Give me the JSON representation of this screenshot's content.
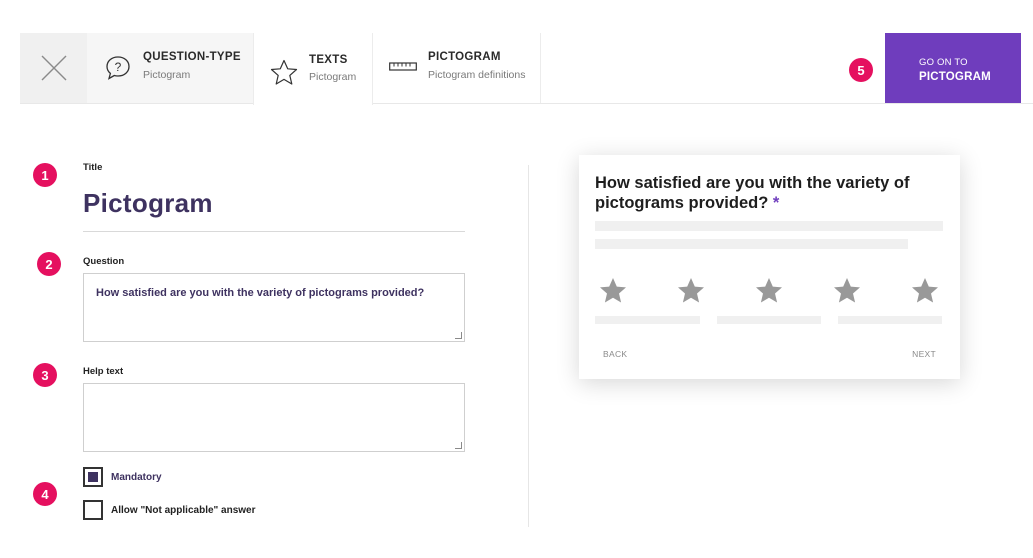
{
  "header": {
    "tabs": [
      {
        "title": "QUESTION-TYPE",
        "subtitle": "Pictogram",
        "icon": "question-bubble-icon"
      },
      {
        "title": "TEXTS",
        "subtitle": "Pictogram",
        "icon": "star-outline-icon",
        "active": true
      },
      {
        "title": "PICTOGRAM",
        "subtitle": "Pictogram definitions",
        "icon": "ruler-icon"
      }
    ],
    "goto": {
      "line1": "GO ON TO",
      "line2": "PICTOGRAM"
    },
    "step_badge": "5"
  },
  "form": {
    "steps": [
      "1",
      "2",
      "3",
      "4"
    ],
    "title_label": "Title",
    "title_value": "Pictogram",
    "question_label": "Question",
    "question_value": "How satisfied are you with the variety of pictograms provided?",
    "helptext_label": "Help text",
    "helptext_value": "",
    "mandatory_label": "Mandatory",
    "mandatory_checked": true,
    "not_applicable_label": "Allow \"Not applicable\" answer",
    "not_applicable_checked": false
  },
  "preview": {
    "question": "How satisfied are you with the variety of pictograms provided?",
    "required_mark": "*",
    "star_count": 5,
    "back_label": "BACK",
    "next_label": "NEXT"
  },
  "colors": {
    "accent": "#6f3dbd",
    "badge": "#e5105f",
    "title_text": "#3e3260",
    "star": "#999999"
  }
}
